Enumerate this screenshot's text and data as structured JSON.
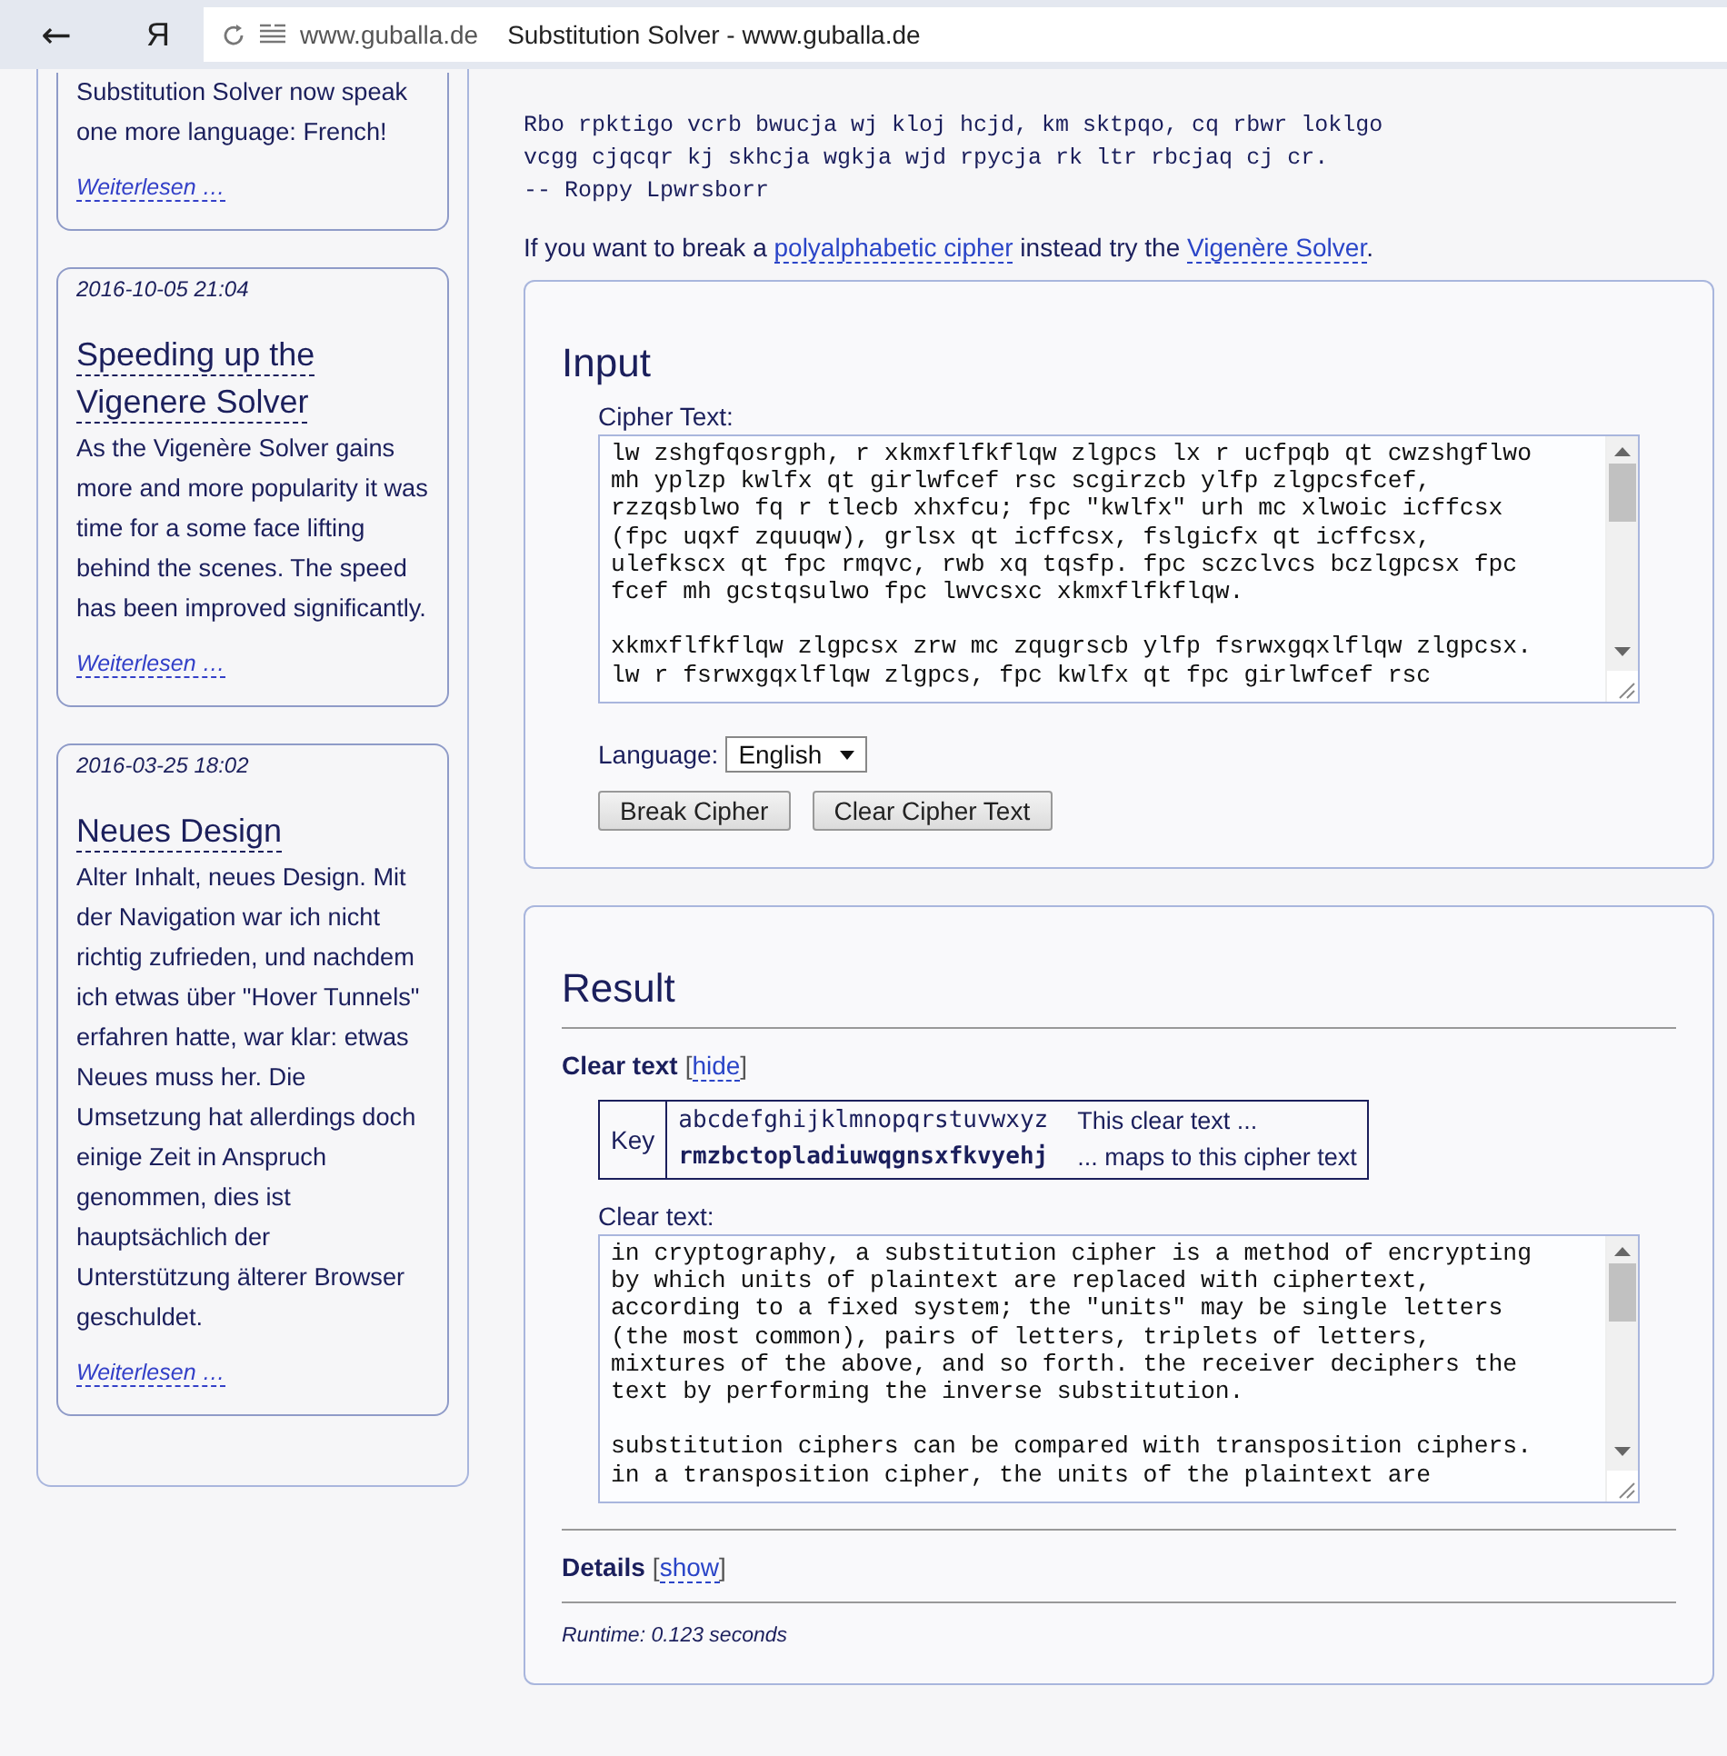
{
  "browser": {
    "back": "←",
    "logo": "Я",
    "domain": "www.guballa.de",
    "page_title": "Substitution Solver - www.guballa.de"
  },
  "sidebar": {
    "news": [
      {
        "body": "Substitution Solver now speak one more language: French!",
        "link": "Weiterlesen …"
      },
      {
        "date": "2016-10-05 21:04",
        "title": "Speeding up the Vigenere Solver",
        "body": "As the Vigenère Solver gains more and more popularity it was time for a some face lifting behind the scenes. The speed has been improved significantly.",
        "link": "Weiterlesen …"
      },
      {
        "date": "2016-03-25 18:02",
        "title": "Neues Design",
        "body": "Alter Inhalt, neues Design. Mit der Navigation war ich nicht richtig zufrieden, und nachdem ich etwas über \"Hover Tunnels\" erfahren hatte, war klar: etwas Neues muss her. Die Umsetzung hat allerdings doch einige Zeit in Anspruch genommen, dies ist hauptsächlich der Unterstützung älterer Browser geschuldet.",
        "link": "Weiterlesen …"
      }
    ]
  },
  "quote_lines": [
    "Rbo rpktigo vcrb bwucja wj kloj hcjd, km sktpqo, cq rbwr loklgo",
    "vcgg cjqcqr kj skhcja wgkja wjd rpycja rk ltr rbcjaq cj cr.",
    "-- Roppy Lpwrsborr"
  ],
  "intro": [
    {
      "kind": "text",
      "text": "If you want to break a "
    },
    {
      "kind": "link",
      "text": "polyalphabetic cipher"
    },
    {
      "kind": "text",
      "text": " instead try the "
    },
    {
      "kind": "link",
      "text": "Vigenère Solver"
    },
    {
      "kind": "text",
      "text": "."
    }
  ],
  "input": {
    "heading": "Input",
    "cipher_label": "Cipher Text:",
    "cipher_paragraphs": [
      [
        "lw zshgfqosrgph, r xkmxflfkflqw zlgpcs lx r ucfpqb qt cwzshgflwo",
        "mh yplzp kwlfx qt girlwfcef rsc scgirzcb ylfp zlgpcsfcef,",
        "rzzqsblwo fq r tlecb xhxfcu; fpc \"kwlfx\" urh mc xlwoic icffcsx",
        "(fpc uqxf zquuqw), grlsx qt icffcsx, fslgicfx qt icffcsx,",
        "ulefkscx qt fpc rmqvc, rwb xq tqsfp. fpc sczclvcs bczlgpcsx fpc",
        "fcef mh gcstqsulwo fpc lwvcsxc xkmxflfkflqw."
      ],
      [
        "xkmxflfkflqw zlgpcsx zrw mc zqugrscb ylfp fsrwxgqxlflqw zlgpcsx.",
        "lw r fsrwxgqxlflqw zlgpcs, fpc kwlfx qt fpc girlwfcef rsc"
      ]
    ],
    "language_label": "Language:",
    "language": "English",
    "buttons": [
      "Break Cipher",
      "Clear Cipher Text"
    ]
  },
  "result": {
    "heading": "Result",
    "clear_text": {
      "title": "Clear text",
      "open": "[",
      "link": "hide",
      "close": "]"
    },
    "key": {
      "label": "Key",
      "plain": "abcdefghijklmnopqrstuvwxyz",
      "cipher": "rmzbctopladiuwqgnsxfkvyehj",
      "plain_note": "This clear text ...",
      "cipher_note": "... maps to this cipher text"
    },
    "clear_label": "Clear text:",
    "clear_paragraphs": [
      [
        "in cryptography, a substitution cipher is a method of encrypting",
        "by which units of plaintext are replaced with ciphertext,",
        "according to a fixed system; the \"units\" may be single letters",
        "(the most common), pairs of letters, triplets of letters,",
        "mixtures of the above, and so forth. the receiver deciphers the",
        "text by performing the inverse substitution."
      ],
      [
        "substitution ciphers can be compared with transposition ciphers.",
        "in a transposition cipher, the units of the plaintext are"
      ]
    ],
    "details": {
      "title": "Details",
      "open": "[",
      "link": "show",
      "close": "]"
    },
    "runtime": "Runtime: 0.123 seconds"
  }
}
